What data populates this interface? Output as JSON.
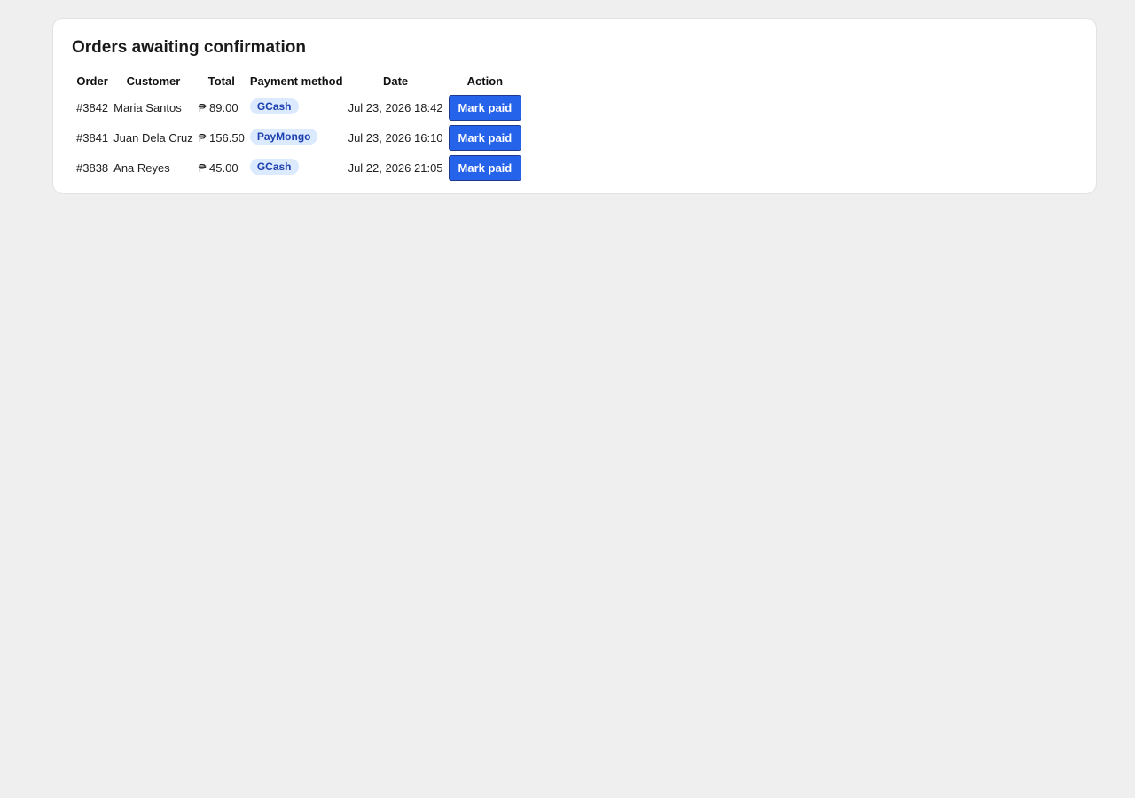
{
  "page": {
    "title": "Orders awaiting confirmation"
  },
  "table": {
    "headers": {
      "order": "Order",
      "customer": "Customer",
      "total": "Total",
      "payment_method": "Payment method",
      "date": "Date",
      "action": "Action"
    },
    "rows": [
      {
        "order": "#3842",
        "customer": "Maria Santos",
        "total": "₱ 89.00",
        "payment_method": "GCash",
        "date": "Jul 23, 2026 18:42",
        "action_label": "Mark paid"
      },
      {
        "order": "#3841",
        "customer": "Juan Dela Cruz",
        "total": "₱ 156.50",
        "payment_method": "PayMongo",
        "date": "Jul 23, 2026 16:10",
        "action_label": "Mark paid"
      },
      {
        "order": "#3838",
        "customer": "Ana Reyes",
        "total": "₱ 45.00",
        "payment_method": "GCash",
        "date": "Jul 22, 2026 21:05",
        "action_label": "Mark paid"
      }
    ]
  },
  "colors": {
    "background": "#efefef",
    "card": "#ffffff",
    "button": "#2563eb",
    "badge_bg": "#dbeafe",
    "badge_text": "#1e40af"
  }
}
